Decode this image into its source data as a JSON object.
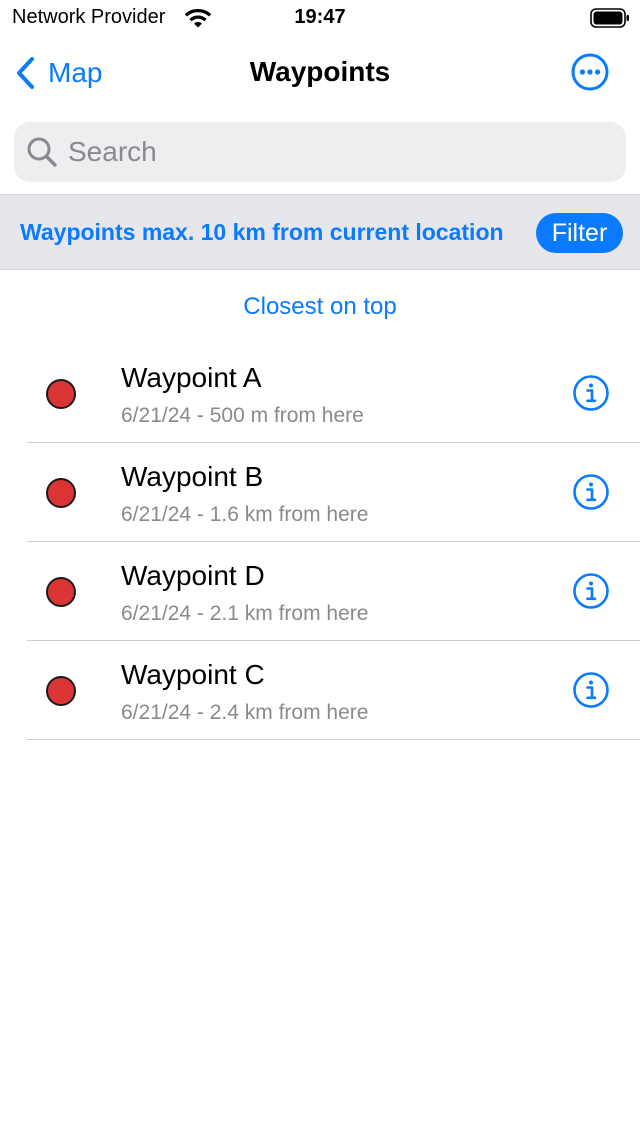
{
  "status_bar": {
    "carrier": "Network Provider",
    "time": "19:47"
  },
  "nav": {
    "back_label": "Map",
    "title": "Waypoints"
  },
  "search": {
    "placeholder": "Search",
    "value": ""
  },
  "filter_bar": {
    "text": "Waypoints max. 10 km from current location",
    "button_label": "Filter"
  },
  "sort_label": "Closest on top",
  "waypoints": [
    {
      "name": "Waypoint A",
      "detail": "6/21/24 - 500 m from here"
    },
    {
      "name": "Waypoint B",
      "detail": "6/21/24 - 1.6 km from here"
    },
    {
      "name": "Waypoint D",
      "detail": "6/21/24 - 2.1 km from here"
    },
    {
      "name": "Waypoint C",
      "detail": "6/21/24 - 2.4 km from here"
    }
  ],
  "icons": {
    "back": "chevron-left-icon",
    "more": "ellipsis-circle-icon",
    "search": "magnifier-icon",
    "info": "info-circle-icon",
    "waypoint_marker": "red-dot-icon"
  },
  "colors": {
    "accent": "#0a7aff",
    "marker": "#db3434",
    "filter_background": "#e6e6eb",
    "secondary_text": "#8a8a8e"
  }
}
